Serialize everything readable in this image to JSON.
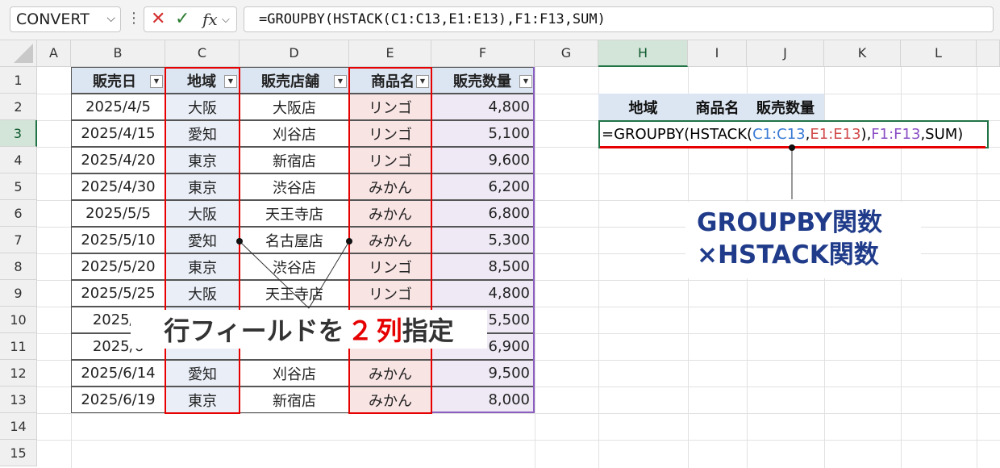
{
  "toolbar": {
    "name_box": "CONVERT",
    "dots": "⋮",
    "cancel_icon": "✕",
    "enter_icon": "✓",
    "fx_label": "fx",
    "formula": "=GROUPBY(HSTACK(C1:C13,E1:E13),F1:F13,SUM)"
  },
  "columns": [
    "A",
    "B",
    "C",
    "D",
    "E",
    "F",
    "G",
    "H",
    "I",
    "J",
    "K",
    "L"
  ],
  "rows": [
    "1",
    "2",
    "3",
    "4",
    "5",
    "6",
    "7",
    "8",
    "9",
    "10",
    "11",
    "12",
    "13",
    "14",
    "15"
  ],
  "table": {
    "headers": [
      "販売日",
      "地域",
      "販売店舗",
      "商品名",
      "販売数量"
    ],
    "filter_icon": "▼",
    "rows": [
      [
        "2025/4/5",
        "大阪",
        "大阪店",
        "リンゴ",
        "4,800"
      ],
      [
        "2025/4/15",
        "愛知",
        "刈谷店",
        "リンゴ",
        "5,100"
      ],
      [
        "2025/4/20",
        "東京",
        "新宿店",
        "リンゴ",
        "9,600"
      ],
      [
        "2025/4/30",
        "東京",
        "渋谷店",
        "みかん",
        "6,200"
      ],
      [
        "2025/5/5",
        "大阪",
        "天王寺店",
        "みかん",
        "6,800"
      ],
      [
        "2025/5/10",
        "愛知",
        "名古屋店",
        "みかん",
        "5,300"
      ],
      [
        "2025/5/20",
        "東京",
        "渋谷店",
        "リンゴ",
        "8,500"
      ],
      [
        "2025/5/25",
        "大阪",
        "天王寺店",
        "リンゴ",
        "4,800"
      ],
      [
        "2025/5",
        "",
        "",
        "",
        "5,500"
      ],
      [
        "2025/6",
        "",
        "",
        "",
        "6,900"
      ],
      [
        "2025/6/14",
        "愛知",
        "刈谷店",
        "みかん",
        "9,500"
      ],
      [
        "2025/6/19",
        "東京",
        "新宿店",
        "みかん",
        "8,000"
      ]
    ]
  },
  "result_headers": [
    "地域",
    "商品名",
    "販売数量"
  ],
  "cell_formula": {
    "p1": "=GROUPBY(HSTACK(",
    "p2": "C1:C13",
    "p3": ",",
    "p4": "E1:E13",
    "p5": "),",
    "p6": "F1:F13",
    "p7": ",SUM)"
  },
  "callouts": {
    "rows_a": "行フィールドを",
    "rows_num": "２",
    "rows_b": "列",
    "rows_c": "指定",
    "func_line1": "GROUPBY関数",
    "func_line2": "×HSTACK関数"
  },
  "colors": {
    "accent": "#217346",
    "highlight": "#e60000",
    "callout_blue": "#1f3b8a"
  }
}
